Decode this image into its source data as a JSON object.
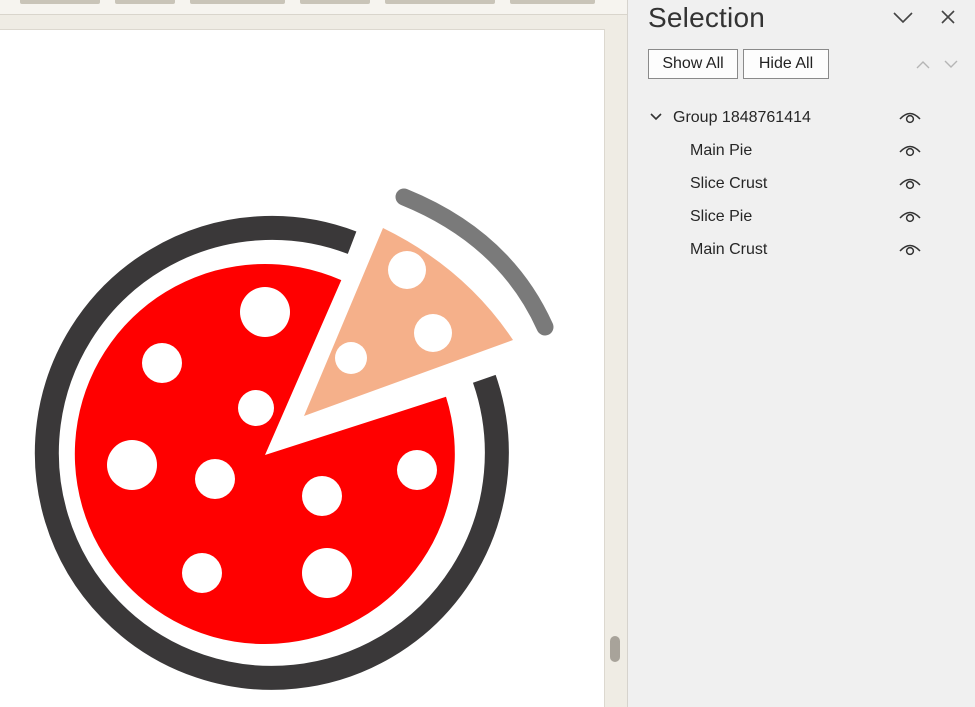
{
  "pane": {
    "title": "Selection",
    "show_all_label": "Show All",
    "hide_all_label": "Hide All"
  },
  "tree": {
    "group": {
      "label": "Group 1848761414",
      "expanded": true,
      "icon": "chevron-down-icon",
      "visibility_icon": "eye-icon"
    },
    "children": [
      {
        "label": "Main Pie",
        "visibility_icon": "eye-icon"
      },
      {
        "label": "Slice Crust",
        "visibility_icon": "eye-icon"
      },
      {
        "label": "Slice Pie",
        "visibility_icon": "eye-icon"
      },
      {
        "label": "Main Crust",
        "visibility_icon": "eye-icon"
      }
    ]
  },
  "icons": {
    "collapse": "chevron-down-icon",
    "close": "close-icon",
    "bring_forward": "chevron-up-icon",
    "send_backward": "chevron-down-icon"
  },
  "colors": {
    "pie_red": "#ff0000",
    "crust_dark": "#3a3839",
    "slice_pie": "#f5b08a",
    "slice_crust": "#7a7a7a",
    "pepperoni": "#ffffff"
  }
}
